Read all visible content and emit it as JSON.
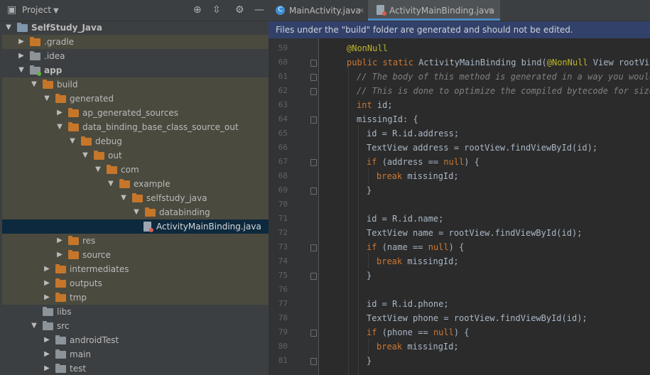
{
  "project_panel": {
    "title": "Project",
    "tree": [
      {
        "label": "SelfStudy_Java",
        "level": 0,
        "expanded": true,
        "folder_color": "blue",
        "style": "bold"
      },
      {
        "label": ".gradle",
        "level": 1,
        "expanded": false,
        "folder_color": "orange",
        "style": "excluded"
      },
      {
        "label": ".idea",
        "level": 1,
        "expanded": false,
        "folder_color": "gray"
      },
      {
        "label": "app",
        "level": 1,
        "expanded": true,
        "folder_color": "gray",
        "style": "bold",
        "module_dot": true
      },
      {
        "label": "build",
        "level": 2,
        "expanded": true,
        "folder_color": "orange",
        "style": "excluded"
      },
      {
        "label": "generated",
        "level": 3,
        "expanded": true,
        "folder_color": "orange",
        "style": "excluded"
      },
      {
        "label": "ap_generated_sources",
        "level": 4,
        "expanded": false,
        "folder_color": "orange",
        "style": "excluded"
      },
      {
        "label": "data_binding_base_class_source_out",
        "level": 4,
        "expanded": true,
        "folder_color": "orange",
        "style": "excluded"
      },
      {
        "label": "debug",
        "level": 5,
        "expanded": true,
        "folder_color": "orange",
        "style": "excluded"
      },
      {
        "label": "out",
        "level": 6,
        "expanded": true,
        "folder_color": "orange",
        "style": "excluded"
      },
      {
        "label": "com",
        "level": 7,
        "expanded": true,
        "folder_color": "orange",
        "style": "excluded"
      },
      {
        "label": "example",
        "level": 8,
        "expanded": true,
        "folder_color": "orange",
        "style": "excluded"
      },
      {
        "label": "selfstudy_java",
        "level": 9,
        "expanded": true,
        "folder_color": "orange",
        "style": "excluded"
      },
      {
        "label": "databinding",
        "level": 10,
        "expanded": true,
        "folder_color": "orange",
        "style": "excluded"
      },
      {
        "label": "ActivityMainBinding.java",
        "level": 11,
        "file": true,
        "style": "selected"
      },
      {
        "label": "res",
        "level": 4,
        "expanded": false,
        "folder_color": "orange",
        "style": "excluded"
      },
      {
        "label": "source",
        "level": 4,
        "expanded": false,
        "folder_color": "orange",
        "style": "excluded"
      },
      {
        "label": "intermediates",
        "level": 3,
        "expanded": false,
        "folder_color": "orange",
        "style": "excluded"
      },
      {
        "label": "outputs",
        "level": 3,
        "expanded": false,
        "folder_color": "orange",
        "style": "excluded"
      },
      {
        "label": "tmp",
        "level": 3,
        "expanded": false,
        "folder_color": "orange",
        "style": "excluded"
      },
      {
        "label": "libs",
        "level": 2,
        "leaf": true,
        "folder_color": "gray"
      },
      {
        "label": "src",
        "level": 2,
        "expanded": true,
        "folder_color": "gray"
      },
      {
        "label": "androidTest",
        "level": 3,
        "expanded": false,
        "folder_color": "gray"
      },
      {
        "label": "main",
        "level": 3,
        "expanded": false,
        "folder_color": "gray"
      },
      {
        "label": "test",
        "level": 3,
        "expanded": false,
        "folder_color": "gray"
      }
    ]
  },
  "editor": {
    "tabs": [
      {
        "label": "MainActivity.java",
        "active": false,
        "close": "×"
      },
      {
        "label": "ActivityMainBinding.java",
        "active": true,
        "close": "×"
      }
    ],
    "banner": "Files under the \"build\" folder are generated and should not be edited.",
    "lines": [
      {
        "n": "59",
        "indent": 4,
        "parts": [
          {
            "t": "@NonNull",
            "c": "an"
          }
        ]
      },
      {
        "n": "60",
        "indent": 4,
        "fold": true,
        "parts": [
          {
            "t": "public static ",
            "c": "kw"
          },
          {
            "t": "ActivityMainBinding bind(",
            "c": ""
          },
          {
            "t": "@NonNull",
            "c": "an"
          },
          {
            "t": " View rootView) {",
            "c": ""
          }
        ]
      },
      {
        "n": "61",
        "indent": 6,
        "fold": true,
        "parts": [
          {
            "t": "// The body of this method is generated in a way you would not",
            "c": "cm"
          }
        ]
      },
      {
        "n": "62",
        "indent": 6,
        "fold": true,
        "parts": [
          {
            "t": "// This is done to optimize the compiled bytecode for size and",
            "c": "cm"
          }
        ]
      },
      {
        "n": "63",
        "indent": 6,
        "parts": [
          {
            "t": "int ",
            "c": "kw"
          },
          {
            "t": "id;",
            "c": ""
          }
        ]
      },
      {
        "n": "64",
        "indent": 6,
        "fold": true,
        "parts": [
          {
            "t": "missingId: {",
            "c": ""
          }
        ]
      },
      {
        "n": "65",
        "indent": 8,
        "parts": [
          {
            "t": "id = R.id.address;",
            "c": ""
          }
        ]
      },
      {
        "n": "66",
        "indent": 8,
        "parts": [
          {
            "t": "TextView address = rootView.findViewById(id);",
            "c": ""
          }
        ]
      },
      {
        "n": "67",
        "indent": 8,
        "fold": true,
        "parts": [
          {
            "t": "if ",
            "c": "kw"
          },
          {
            "t": "(address == ",
            "c": ""
          },
          {
            "t": "null",
            "c": "kw"
          },
          {
            "t": ") {",
            "c": ""
          }
        ]
      },
      {
        "n": "68",
        "indent": 10,
        "parts": [
          {
            "t": "break ",
            "c": "kw"
          },
          {
            "t": "missingId;",
            "c": ""
          }
        ]
      },
      {
        "n": "69",
        "indent": 8,
        "fold": true,
        "parts": [
          {
            "t": "}",
            "c": ""
          }
        ]
      },
      {
        "n": "70",
        "indent": 0,
        "parts": []
      },
      {
        "n": "71",
        "indent": 8,
        "parts": [
          {
            "t": "id = R.id.name;",
            "c": ""
          }
        ]
      },
      {
        "n": "72",
        "indent": 8,
        "parts": [
          {
            "t": "TextView name = rootView.findViewById(id);",
            "c": ""
          }
        ]
      },
      {
        "n": "73",
        "indent": 8,
        "fold": true,
        "parts": [
          {
            "t": "if ",
            "c": "kw"
          },
          {
            "t": "(name == ",
            "c": ""
          },
          {
            "t": "null",
            "c": "kw"
          },
          {
            "t": ") {",
            "c": ""
          }
        ]
      },
      {
        "n": "74",
        "indent": 10,
        "parts": [
          {
            "t": "break ",
            "c": "kw"
          },
          {
            "t": "missingId;",
            "c": ""
          }
        ]
      },
      {
        "n": "75",
        "indent": 8,
        "fold": true,
        "parts": [
          {
            "t": "}",
            "c": ""
          }
        ]
      },
      {
        "n": "76",
        "indent": 0,
        "parts": []
      },
      {
        "n": "77",
        "indent": 8,
        "parts": [
          {
            "t": "id = R.id.phone;",
            "c": ""
          }
        ]
      },
      {
        "n": "78",
        "indent": 8,
        "parts": [
          {
            "t": "TextView phone = rootView.findViewById(id);",
            "c": ""
          }
        ]
      },
      {
        "n": "79",
        "indent": 8,
        "fold": true,
        "parts": [
          {
            "t": "if ",
            "c": "kw"
          },
          {
            "t": "(phone == ",
            "c": ""
          },
          {
            "t": "null",
            "c": "kw"
          },
          {
            "t": ") {",
            "c": ""
          }
        ]
      },
      {
        "n": "80",
        "indent": 10,
        "parts": [
          {
            "t": "break ",
            "c": "kw"
          },
          {
            "t": "missingId;",
            "c": ""
          }
        ]
      },
      {
        "n": "81",
        "indent": 8,
        "fold": true,
        "parts": [
          {
            "t": "}",
            "c": ""
          }
        ]
      }
    ]
  },
  "colors": {
    "accent": "#4a88c7",
    "banner_bg": "#32416a",
    "selection_bg": "#0d293e",
    "excluded_bg": "#4a4a3f"
  }
}
